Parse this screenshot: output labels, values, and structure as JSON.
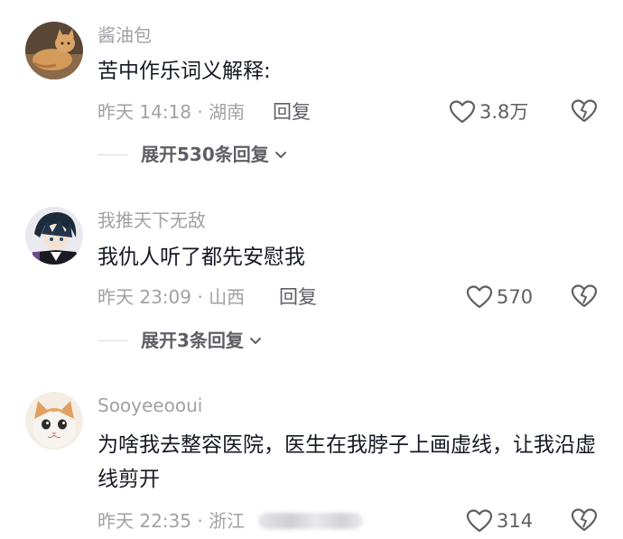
{
  "comments": [
    {
      "username": "酱油包",
      "content": "苦中作乐词义解释:",
      "time_location": "昨天 14:18 · 湖南",
      "reply_label": "回复",
      "likes": "3.8万",
      "expand_label": "展开530条回复",
      "avatar_icon": "orange-cat-avatar"
    },
    {
      "username": "我推天下无敌",
      "content": "我仇人听了都先安慰我",
      "time_location": "昨天 23:09 · 山西",
      "reply_label": "回复",
      "likes": "570",
      "expand_label": "展开3条回复",
      "avatar_icon": "anime-boy-avatar"
    },
    {
      "username": "Sooyeeooui",
      "content": "为啥我去整容医院，医生在我脖子上画虚线，让我沿虚线剪开",
      "time_location": "昨天 22:35 · 浙江",
      "likes": "314",
      "avatar_icon": "kitten-avatar"
    }
  ],
  "icons": {
    "like": "heart-outline-icon",
    "dislike": "broken-heart-icon",
    "expand": "chevron-down-icon"
  },
  "colors": {
    "username": "#a1a1a6",
    "content": "#161823",
    "action": "#5e5e66"
  }
}
